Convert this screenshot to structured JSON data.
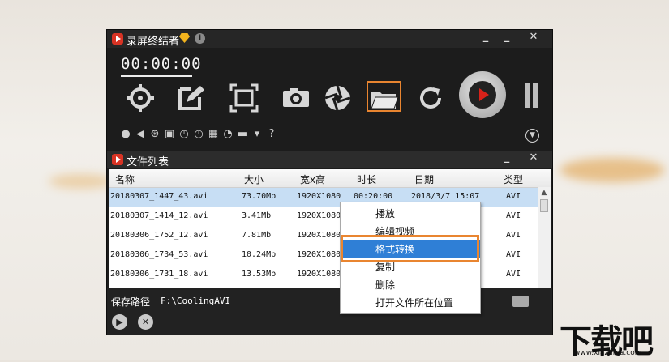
{
  "app": {
    "title": "录屏终结者",
    "timer": "00:00:00"
  },
  "toolbar": {
    "icons": [
      "crosshair-icon",
      "edit-icon",
      "fullscreen-icon",
      "camera-icon",
      "aperture-icon",
      "folder-icon",
      "refresh-icon"
    ]
  },
  "filelist": {
    "title": "文件列表",
    "columns": [
      "名称",
      "大小",
      "宽x高",
      "时长",
      "日期",
      "类型"
    ],
    "rows": [
      {
        "name": "20180307_1447_43.avi",
        "size": "73.70Mb",
        "res": "1920X1080",
        "dur": "00:20:00",
        "date": "2018/3/7 15:07",
        "type": "AVI",
        "selected": true
      },
      {
        "name": "20180307_1414_12.avi",
        "size": "3.41Mb",
        "res": "1920X1080",
        "dur": "",
        "date": "",
        "type": "AVI"
      },
      {
        "name": "20180306_1752_12.avi",
        "size": "7.81Mb",
        "res": "1920X1080",
        "dur": "",
        "date": "",
        "type": "AVI"
      },
      {
        "name": "20180306_1734_53.avi",
        "size": "10.24Mb",
        "res": "1920X1080",
        "dur": "",
        "date": "",
        "type": "AVI"
      },
      {
        "name": "20180306_1731_18.avi",
        "size": "13.53Mb",
        "res": "1920X1080",
        "dur": "",
        "date": "",
        "type": "AVI"
      }
    ]
  },
  "save": {
    "label": "保存路径",
    "path": "F:\\CoolingAVI"
  },
  "context_menu": {
    "items": [
      "播放",
      "编辑视频",
      "格式转换",
      "复制",
      "删除",
      "打开文件所在位置"
    ],
    "active": "格式转换"
  },
  "watermark": {
    "text": "下载吧",
    "url": "www.xiazaiba.com"
  },
  "colors": {
    "highlight": "#e98530",
    "selection": "#2f7fd6",
    "record": "#d8221a"
  }
}
